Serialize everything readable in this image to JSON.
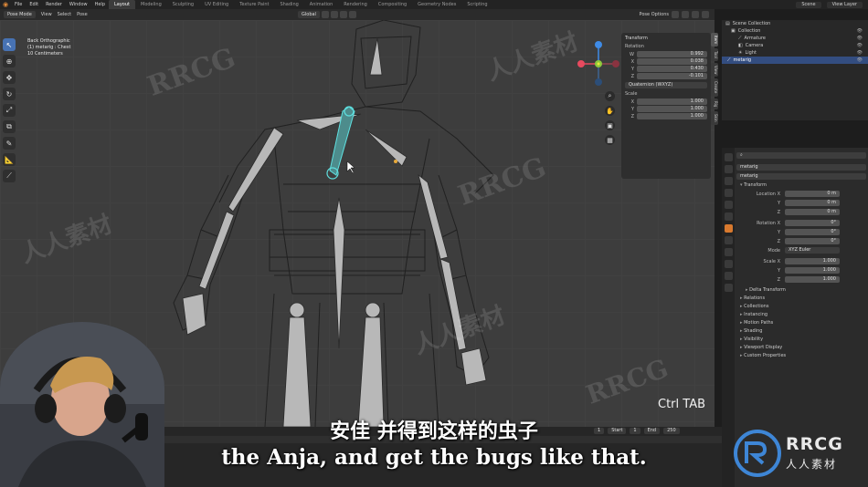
{
  "menubar": {
    "items": [
      "File",
      "Edit",
      "Render",
      "Window",
      "Help"
    ],
    "workspaces": [
      "Layout",
      "Modeling",
      "Sculpting",
      "UV Editing",
      "Texture Paint",
      "Shading",
      "Animation",
      "Rendering",
      "Compositing",
      "Geometry Nodes",
      "Scripting"
    ],
    "active_workspace": "Layout",
    "scene": "Scene",
    "view_layer": "View Layer"
  },
  "viewport_header": {
    "mode": "Pose Mode",
    "menus": [
      "View",
      "Select",
      "Pose"
    ],
    "transform_orientation": "Global",
    "pose_options": "Pose Options"
  },
  "viewport_info": {
    "line1": "Back Orthographic",
    "line2": "(1) metarig : Chest",
    "line3": "10 Centimeters"
  },
  "gizmo": {
    "x_color": "#e84a5f",
    "y_color": "#8cc83c",
    "z_color": "#3f8be6",
    "center_color": "#e8e83a"
  },
  "npanel": {
    "title": "Transform",
    "rotation_label": "Rotation",
    "rotation": [
      {
        "axis": "W",
        "value": "0.992"
      },
      {
        "axis": "X",
        "value": "0.038"
      },
      {
        "axis": "Y",
        "value": "0.430"
      },
      {
        "axis": "Z",
        "value": "-0.101"
      }
    ],
    "rotation_mode": "Quaternion (WXYZ)",
    "scale_label": "Scale",
    "scale": [
      {
        "axis": "X",
        "value": "1.000"
      },
      {
        "axis": "Y",
        "value": "1.000"
      },
      {
        "axis": "Z",
        "value": "1.000"
      }
    ],
    "tabs": [
      "Item",
      "Tool",
      "View",
      "Create",
      "Rig",
      "Skin"
    ]
  },
  "outliner": {
    "rows": [
      {
        "label": "Scene Collection",
        "selected": false
      },
      {
        "label": "Collection",
        "selected": false
      },
      {
        "label": "Armature",
        "selected": false
      },
      {
        "label": "Camera",
        "selected": false
      },
      {
        "label": "Light",
        "selected": false
      },
      {
        "label": "metarig",
        "selected": true
      }
    ]
  },
  "properties": {
    "object_name": "metarig",
    "object_field": "metarig",
    "transform_label": "Transform",
    "location_label": "Location X",
    "location": [
      "0 m",
      "0 m",
      "0 m"
    ],
    "rotation_label": "Rotation X",
    "rotation": [
      "0°",
      "0°",
      "0°"
    ],
    "mode_label": "Mode",
    "mode_value": "XYZ Euler",
    "scale_label": "Scale X",
    "scale": [
      "1.000",
      "1.000",
      "1.000"
    ],
    "sections": [
      "Delta Transform",
      "Relations",
      "Collections",
      "Instancing",
      "Motion Paths",
      "Shading",
      "Visibility",
      "Viewport Display",
      "Custom Properties"
    ]
  },
  "timeline": {
    "current_frame": "1",
    "start_label": "Start",
    "start": "1",
    "end_label": "End",
    "end": "250"
  },
  "overlay": {
    "key_hint": "Ctrl TAB",
    "subtitle_cn": "安佳 并得到这样的虫子",
    "subtitle_en": "the Anja, and get the bugs like that."
  },
  "brand": {
    "name": "RRCG",
    "tagline": "人人素材"
  }
}
